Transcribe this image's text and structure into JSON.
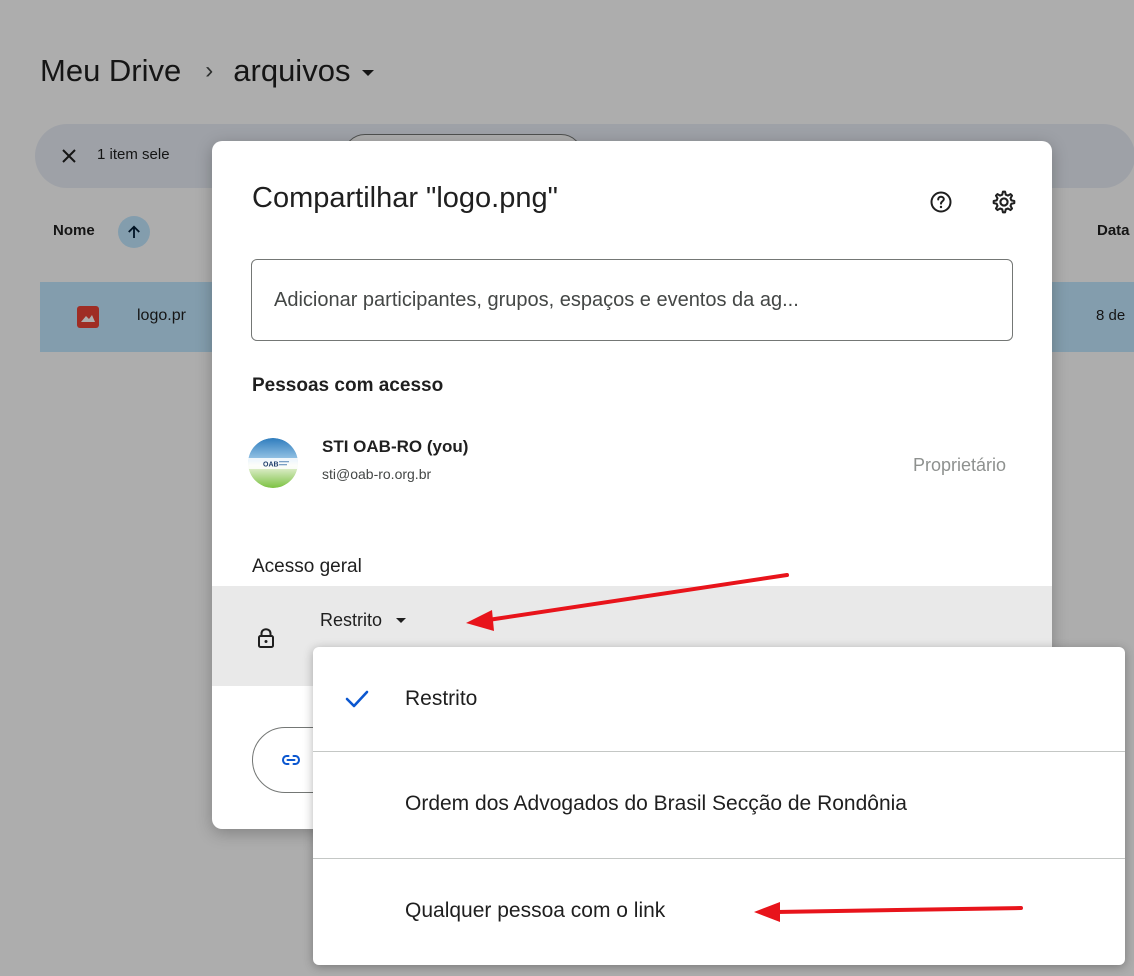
{
  "breadcrumb": {
    "root": "Meu Drive",
    "separator": "›",
    "current": "arquivos"
  },
  "selection_bar": {
    "count_text": "1 item sele"
  },
  "file_list": {
    "col_name": "Nome",
    "col_date": "Data",
    "rows": [
      {
        "name": "logo.pr",
        "date": "8 de"
      }
    ]
  },
  "bg_stray": "l",
  "dialog": {
    "title": "Compartilhar \"logo.png\"",
    "add_placeholder": "Adicionar participantes, grupos, espaços e eventos da ag...",
    "people_heading": "Pessoas com acesso",
    "person": {
      "name": "STI OAB-RO (you)",
      "email": "sti@oab-ro.org.br",
      "role": "Proprietário",
      "avatar_text": "OAB"
    },
    "general_heading": "Acesso geral",
    "access_value": "Restrito"
  },
  "menu": {
    "options": [
      {
        "label": "Restrito",
        "selected": true
      },
      {
        "label": "Ordem dos Advogados do Brasil Secção de Rondônia",
        "selected": false
      },
      {
        "label": "Qualquer pessoa com o link",
        "selected": false
      }
    ]
  },
  "colors": {
    "accent_blue": "#0b57d0",
    "selection_blue": "#c2e7ff",
    "annotation_red": "#e8141b",
    "file_icon_red": "#ea4335"
  }
}
